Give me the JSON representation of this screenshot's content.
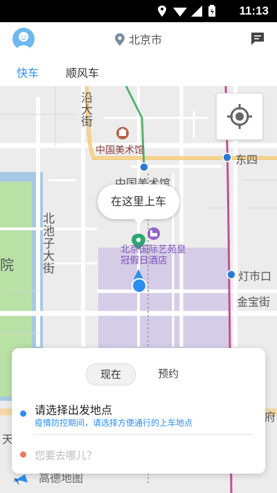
{
  "status_bar": {
    "time": "11:13"
  },
  "header": {
    "city": "北京市"
  },
  "tabs": [
    {
      "label": "快车"
    },
    {
      "label": "顺风车"
    }
  ],
  "map": {
    "pickup_bubble": "在这里上车",
    "labels": {
      "street_yanhong": "沿大街",
      "museum_1": "中国美术馆",
      "museum_2": "中国美术馆",
      "station_dongsi": "东四",
      "beichi": "北池子大街",
      "yuan": "院",
      "hotel": "北京国际艺苑皇冠假日酒店",
      "dengshikou": "灯市口",
      "jinbao": "金宝街",
      "tian": "天",
      "fu": "府",
      "logo": "高德地图"
    }
  },
  "panel": {
    "tabs": [
      {
        "label": "现在"
      },
      {
        "label": "预约"
      }
    ],
    "start_label": "请选择出发地点",
    "start_hint": "疫情防控期间，请选择方便通行的上车地点",
    "destination_placeholder": "您要去哪儿？"
  },
  "colors": {
    "accent": "#2c8ef0",
    "start_dot": "#2c8ef0",
    "dest_dot": "#f2775f"
  }
}
